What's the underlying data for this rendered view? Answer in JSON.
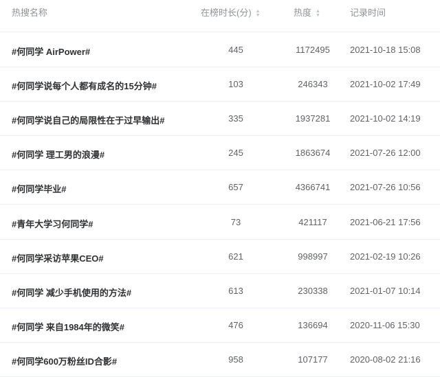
{
  "header": {
    "name": "热搜名称",
    "duration": "在榜时长(分)",
    "heat": "热度",
    "time": "记录时间"
  },
  "rows": [
    {
      "name": "#何同学 AirPower#",
      "duration": "445",
      "heat": "1172495",
      "time": "2021-10-18 15:08"
    },
    {
      "name": "#何同学说每个人都有成名的15分钟#",
      "duration": "103",
      "heat": "246343",
      "time": "2021-10-02 17:49"
    },
    {
      "name": "#何同学说自己的局限性在于过早输出#",
      "duration": "335",
      "heat": "1937281",
      "time": "2021-10-02 14:19"
    },
    {
      "name": "#何同学 理工男的浪漫#",
      "duration": "245",
      "heat": "1863674",
      "time": "2021-07-26 12:00"
    },
    {
      "name": "#何同学毕业#",
      "duration": "657",
      "heat": "4366741",
      "time": "2021-07-26 10:56"
    },
    {
      "name": "#青年大学习何同学#",
      "duration": "73",
      "heat": "421117",
      "time": "2021-06-21 17:56"
    },
    {
      "name": "#何同学采访苹果CEO#",
      "duration": "621",
      "heat": "998997",
      "time": "2021-02-19 10:26"
    },
    {
      "name": "#何同学 减少手机使用的方法#",
      "duration": "613",
      "heat": "230338",
      "time": "2021-01-07 10:14"
    },
    {
      "name": "#何同学 来自1984年的微笑#",
      "duration": "476",
      "heat": "136694",
      "time": "2020-11-06 15:30"
    },
    {
      "name": "#何同学600万粉丝ID合影#",
      "duration": "958",
      "heat": "107177",
      "time": "2020-08-02 21:16"
    }
  ]
}
